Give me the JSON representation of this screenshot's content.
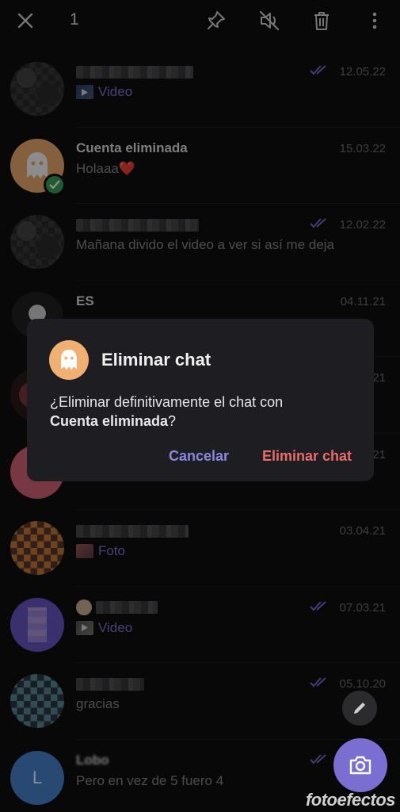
{
  "topbar": {
    "selected_count": "1"
  },
  "chats": [
    {
      "name": "",
      "message": "Video",
      "date": "12.05.22",
      "ticks": true,
      "media": "video"
    },
    {
      "name": "Cuenta eliminada",
      "message": "Holaaa❤️",
      "date": "15.03.22",
      "ticks": false
    },
    {
      "name": "",
      "message": "Mañana divido el video a ver si así me deja",
      "date": "12.02.22",
      "ticks": true
    },
    {
      "name": "ES",
      "message": "",
      "date": "04.11.21",
      "ticks": false
    },
    {
      "name": "",
      "message": "",
      "date": "21",
      "ticks": false
    },
    {
      "name": "",
      "message": "",
      "date": "21",
      "ticks": false
    },
    {
      "name": "",
      "message": "Foto",
      "date": "03.04.21",
      "ticks": false,
      "media": "photo"
    },
    {
      "name": "",
      "message": "Video",
      "date": "07.03.21",
      "ticks": true,
      "media": "video"
    },
    {
      "name": "",
      "message": "gracias",
      "date": "05.10.20",
      "ticks": true
    },
    {
      "name": "Lobo",
      "message": "Pero en vez de 5 fuero  4",
      "date": "",
      "ticks": true,
      "avatar_letter": "L"
    }
  ],
  "dialog": {
    "title": "Eliminar chat",
    "body_prefix": "¿Eliminar definitivamente el chat con",
    "body_name": "Cuenta eliminada",
    "body_suffix": "?",
    "cancel_label": "Cancelar",
    "delete_label": "Eliminar chat"
  },
  "watermark": "fotoefectos",
  "colors": {
    "accent": "#7a6fd0",
    "danger": "#e96b6b",
    "ghost_avatar": "#f0b072",
    "verified": "#3aa55c"
  }
}
